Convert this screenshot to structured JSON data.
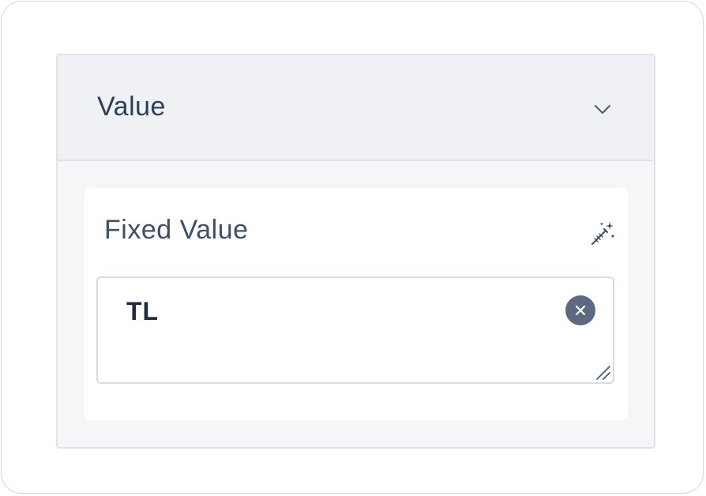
{
  "section": {
    "title": "Value",
    "expand_icon": "chevron-down-icon"
  },
  "field": {
    "label": "Fixed Value",
    "magic_icon": "magic-wand-icon",
    "value": "TL",
    "clear_icon": "close-icon",
    "resize_icon": "resize-handle-icon"
  },
  "colors": {
    "header_bg": "#eff1f4",
    "panel_bg": "#f5f6f8",
    "title_text": "#2d3e58",
    "clear_button_bg": "#5b6a80"
  }
}
